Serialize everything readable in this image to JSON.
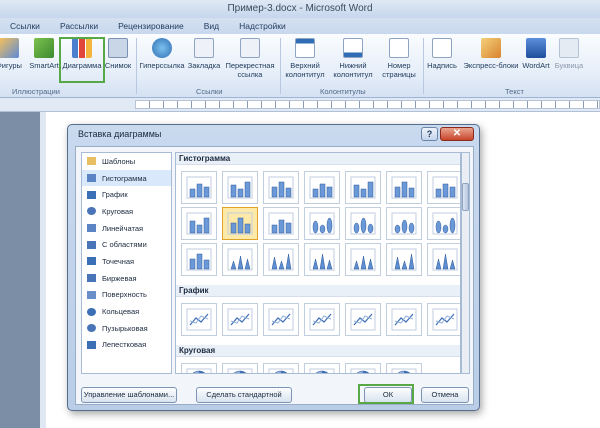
{
  "window": {
    "title": "Пример-3.docx  -  Microsoft Word"
  },
  "ribbon": {
    "tabs": [
      "Ссылки",
      "Рассылки",
      "Рецензирование",
      "Вид",
      "Надстройки"
    ],
    "buttons": [
      {
        "id": "shapes",
        "label": "Фигуры",
        "icon": "shapes-icon"
      },
      {
        "id": "smartart",
        "label": "SmartArt",
        "icon": "smartart-icon"
      },
      {
        "id": "chart",
        "label": "Диаграмма",
        "icon": "chart-icon"
      },
      {
        "id": "screenshot",
        "label": "Снимок",
        "icon": "screenshot-icon"
      },
      {
        "id": "hyperlink",
        "label": "Гиперссылка",
        "icon": "hyperlink-icon"
      },
      {
        "id": "bookmark",
        "label": "Закладка",
        "icon": "bookmark-icon"
      },
      {
        "id": "crossref",
        "label": "Перекрестная ссылка",
        "icon": "crossref-icon"
      },
      {
        "id": "header",
        "label": "Верхний колонтитул",
        "icon": "header-icon"
      },
      {
        "id": "footer",
        "label": "Нижний колонтитул",
        "icon": "footer-icon"
      },
      {
        "id": "pagenum",
        "label": "Номер страницы",
        "icon": "page-number-icon"
      },
      {
        "id": "textbox",
        "label": "Надпись",
        "icon": "textbox-icon"
      },
      {
        "id": "quickparts",
        "label": "Экспресс-блоки",
        "icon": "quickparts-icon"
      },
      {
        "id": "wordart",
        "label": "WordArt",
        "icon": "wordart-icon"
      },
      {
        "id": "dropcap",
        "label": "Буквица",
        "icon": "dropcap-icon"
      }
    ],
    "groups": [
      "Иллюстрации",
      "Ссылки",
      "Колонтитулы",
      "Текст"
    ]
  },
  "dialog": {
    "title": "Вставка диаграммы",
    "help": "?",
    "close": "✕",
    "categories": [
      {
        "label": "Шаблоны",
        "icon": "folder-icon",
        "color": "#e8c063"
      },
      {
        "label": "Гистограмма",
        "icon": "column-chart-icon",
        "color": "#5b84c4",
        "selected": true
      },
      {
        "label": "График",
        "icon": "line-chart-icon",
        "color": "#3b6fb6"
      },
      {
        "label": "Круговая",
        "icon": "pie-chart-icon",
        "color": "#4a74b8"
      },
      {
        "label": "Линейчатая",
        "icon": "bar-chart-icon",
        "color": "#5b84c4"
      },
      {
        "label": "С областями",
        "icon": "area-chart-icon",
        "color": "#4a74b8"
      },
      {
        "label": "Точечная",
        "icon": "scatter-chart-icon",
        "color": "#3b6fb6"
      },
      {
        "label": "Биржевая",
        "icon": "stock-chart-icon",
        "color": "#4a74b8"
      },
      {
        "label": "Поверхность",
        "icon": "surface-chart-icon",
        "color": "#6a8fc8"
      },
      {
        "label": "Кольцевая",
        "icon": "doughnut-chart-icon",
        "color": "#3b6fb6"
      },
      {
        "label": "Пузырьковая",
        "icon": "bubble-chart-icon",
        "color": "#4a74b8"
      },
      {
        "label": "Лепестковая",
        "icon": "radar-chart-icon",
        "color": "#3b6fb6"
      }
    ],
    "sections": [
      {
        "title": "Гистограмма",
        "rows": 3,
        "count": 21,
        "selected_index": 8
      },
      {
        "title": "График",
        "rows": 1,
        "count": 7
      },
      {
        "title": "Круговая",
        "rows": 1,
        "count": 6
      }
    ],
    "buttons": {
      "manage_templates": "Управление шаблонами...",
      "set_default": "Сделать стандартной",
      "ok": "ОК",
      "cancel": "Отмена"
    }
  },
  "colors": {
    "accent": "#3f6db5",
    "highlight": "#58a847",
    "selected": "#fde9a8"
  }
}
